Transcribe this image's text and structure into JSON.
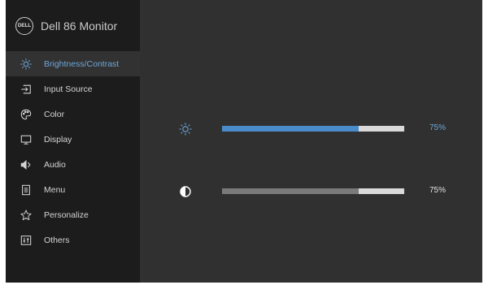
{
  "brand": {
    "logo_text": "DELL",
    "title": "Dell 86 Monitor"
  },
  "sidebar": {
    "items": [
      {
        "label": "Brightness/Contrast",
        "icon": "brightness-icon",
        "active": true
      },
      {
        "label": "Input Source",
        "icon": "input-source-icon",
        "active": false
      },
      {
        "label": "Color",
        "icon": "color-palette-icon",
        "active": false
      },
      {
        "label": "Display",
        "icon": "display-icon",
        "active": false
      },
      {
        "label": "Audio",
        "icon": "speaker-icon",
        "active": false
      },
      {
        "label": "Menu",
        "icon": "menu-icon",
        "active": false
      },
      {
        "label": "Personalize",
        "icon": "star-icon",
        "active": false
      },
      {
        "label": "Others",
        "icon": "others-icon",
        "active": false
      }
    ]
  },
  "settings": {
    "brightness": {
      "icon": "brightness-icon",
      "value": 75,
      "value_text": "75%",
      "color": "#4a8ccb"
    },
    "contrast": {
      "icon": "contrast-icon",
      "value": 75,
      "value_text": "75%",
      "color": "#7a7a7a"
    }
  },
  "colors": {
    "accent": "#6ea6d8",
    "sidebar_bg": "#1c1c1c",
    "panel_bg": "#303030",
    "track": "#d9d9d9"
  }
}
